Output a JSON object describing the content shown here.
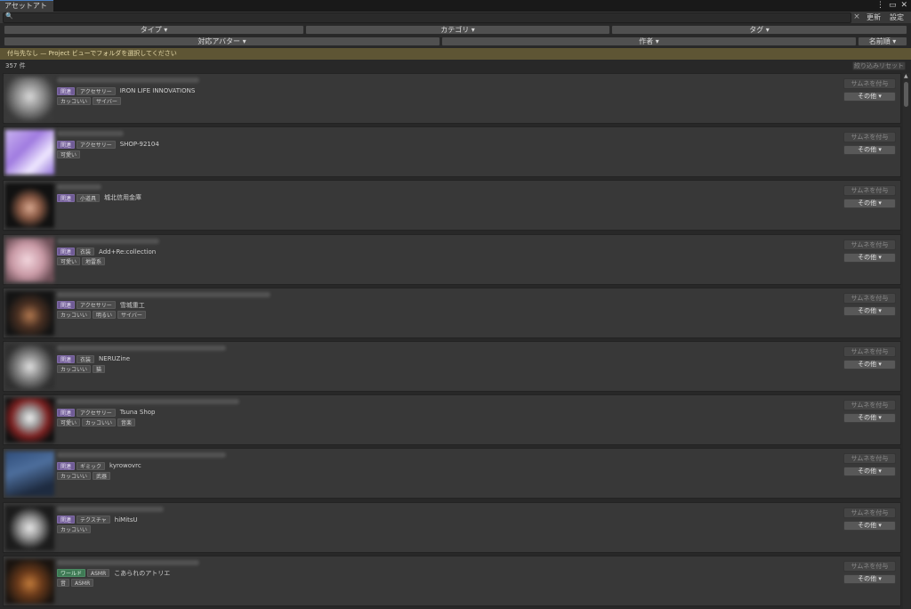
{
  "window": {
    "tab_title": "アセットアトリエ",
    "icons": [
      "more-vertical-icon",
      "maximize-icon",
      "close-icon"
    ]
  },
  "toolbar": {
    "search_placeholder": "",
    "clear": "×",
    "refresh": "更新",
    "settings": "設定"
  },
  "filters": {
    "type": "タイプ ▾",
    "category": "カテゴリ ▾",
    "tag": "タグ ▾",
    "avatar": "対応アバター ▾",
    "author": "作者 ▾",
    "sort": "名前順 ▾"
  },
  "notice": "付与先なし — Project ビューでフォルダを選択してください",
  "count": "357 件",
  "reset": "絞り込みリセット",
  "colors": {
    "relation_chip": "#6f5b95",
    "world_chip": "#3f7a55",
    "notice_bg": "#5e5534"
  },
  "item_buttons": {
    "thumb": "サムネを付与",
    "other": "その他 ▾"
  },
  "items": [
    {
      "rel": "関連",
      "category": "アクセサリー",
      "author": "IRON LIFE INNOVATIONS",
      "tags": [
        "カッコいい",
        "サイバー"
      ]
    },
    {
      "rel": "関連",
      "category": "アクセサリー",
      "author": "SHOP-92104",
      "tags": [
        "可愛い"
      ]
    },
    {
      "rel": "関連",
      "category": "小道具",
      "author": "城北信用金庫",
      "tags": []
    },
    {
      "rel": "関連",
      "category": "衣装",
      "author": "Add+Re:collection",
      "tags": [
        "可愛い",
        "地雷系"
      ]
    },
    {
      "rel": "関連",
      "category": "アクセサリー",
      "author": "雪城重工",
      "tags": [
        "カッコいい",
        "明るい",
        "サイバー"
      ]
    },
    {
      "rel": "関連",
      "category": "衣装",
      "author": "NERUZine",
      "tags": [
        "カッコいい",
        "猫"
      ]
    },
    {
      "rel": "関連",
      "category": "アクセサリー",
      "author": "Tsuna Shop",
      "tags": [
        "可愛い",
        "カッコいい",
        "音楽"
      ]
    },
    {
      "rel": "関連",
      "category": "ギミック",
      "author": "kyrowovrc",
      "tags": [
        "カッコいい",
        "武器"
      ]
    },
    {
      "rel": "関連",
      "category": "テクスチャ",
      "author": "hiMitsU",
      "tags": [
        "カッコいい"
      ]
    },
    {
      "rel": "ワールド",
      "category": "ASMR",
      "author": "こあられのアトリエ",
      "tags": [
        "音",
        "ASMR"
      ]
    }
  ]
}
